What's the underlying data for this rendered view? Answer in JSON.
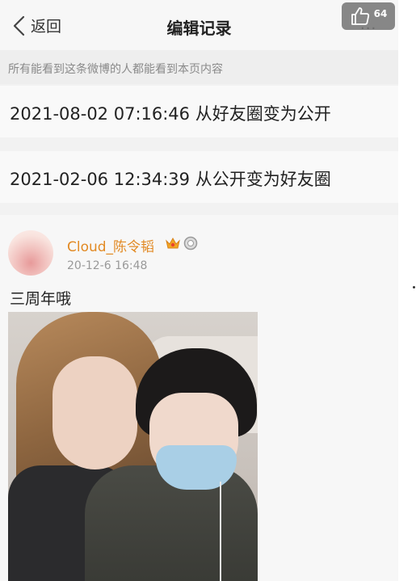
{
  "nav": {
    "back_label": "返回",
    "title": "编辑记录",
    "more": "..."
  },
  "like_badge": {
    "count": "64",
    "icon": "thumbs-up-icon"
  },
  "notice": "所有能看到这条微博的人都能看到本页内容",
  "records": [
    {
      "text": "2021-08-02 07:16:46 从好友圈变为公开"
    },
    {
      "text": "2021-02-06 12:34:39 从公开变为好友圈"
    }
  ],
  "post": {
    "username": "Cloud_陈令韬",
    "time": "20-12-6 16:48",
    "text": "三周年哦",
    "badges": [
      "crown-badge-icon",
      "member-ring-icon"
    ]
  },
  "colors": {
    "username": "#e28a24",
    "background": "#f2f2f2",
    "notice_text": "#8a8a8a"
  }
}
